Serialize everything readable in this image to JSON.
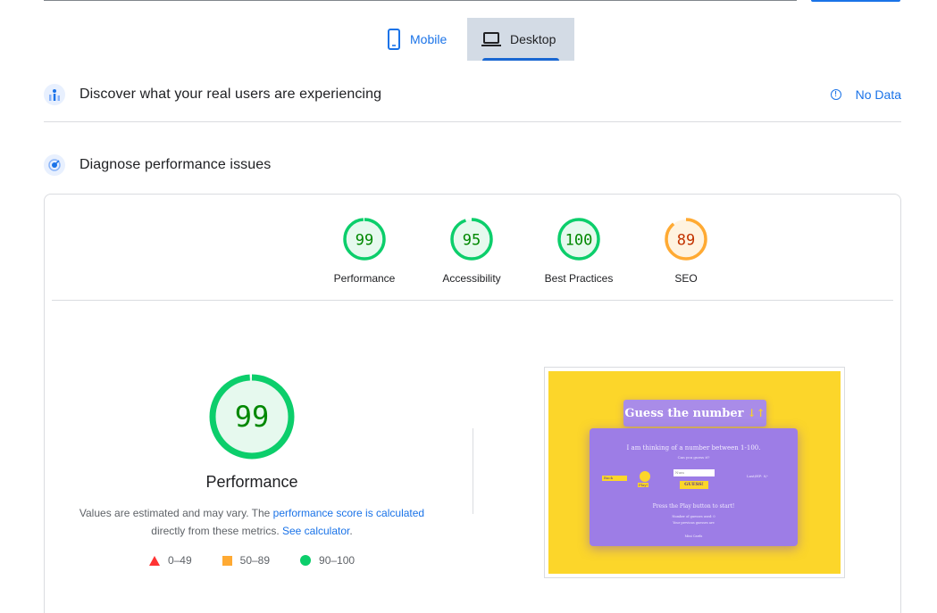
{
  "device_tabs": [
    {
      "label": "Mobile",
      "icon": "smartphone-icon",
      "selected": false
    },
    {
      "label": "Desktop",
      "icon": "laptop-icon",
      "selected": true
    }
  ],
  "field_data": {
    "title": "Discover what your real users are experiencing",
    "status": "No Data",
    "icon": "users-chart-icon"
  },
  "lab_data": {
    "title": "Diagnose performance issues",
    "icon": "diagnose-icon"
  },
  "scores": [
    {
      "label": "Performance",
      "value": "99",
      "score": 99,
      "rating": "pass"
    },
    {
      "label": "Accessibility",
      "value": "95",
      "score": 95,
      "rating": "pass"
    },
    {
      "label": "Best Practices",
      "value": "100",
      "score": 100,
      "rating": "pass"
    },
    {
      "label": "SEO",
      "value": "89",
      "score": 89,
      "rating": "average"
    }
  ],
  "performance": {
    "score_text": "99",
    "score": 99,
    "title": "Performance",
    "note_prefix": "Values are estimated and may vary. The ",
    "note_link1": "performance score is calculated",
    "note_middle": " directly from these metrics. ",
    "note_link2": "See calculator",
    "note_suffix": "."
  },
  "legend": [
    {
      "range": "0–49",
      "shape": "triangle",
      "color": "#ff3333"
    },
    {
      "range": "50–89",
      "shape": "square",
      "color": "#ffaa33"
    },
    {
      "range": "90–100",
      "shape": "circle",
      "color": "#0cce6b"
    }
  ],
  "colors": {
    "pass": "#0cce6b",
    "pass_text": "#008800",
    "pass_bg": "#e6f9ee",
    "average": "#ffaa33",
    "average_text": "#c33300",
    "average_bg": "#fff3e0",
    "link": "#1a73e8"
  },
  "screenshot": {
    "title": "Guess the number",
    "title_icon": "↓↑",
    "line1": "I am thinking of a number between 1-100.",
    "line2": "Can you guess it?",
    "back_label": "Back",
    "play_label": "Play!",
    "input_placeholder": "Num",
    "guess_label": "GUESS!",
    "score_label": "Last/HP: 0/-",
    "line3": "Press the Play button to start!",
    "line4": "Number of guesses used: 0",
    "line5": "Your previous guesses are",
    "footer": "Mini Cards"
  }
}
